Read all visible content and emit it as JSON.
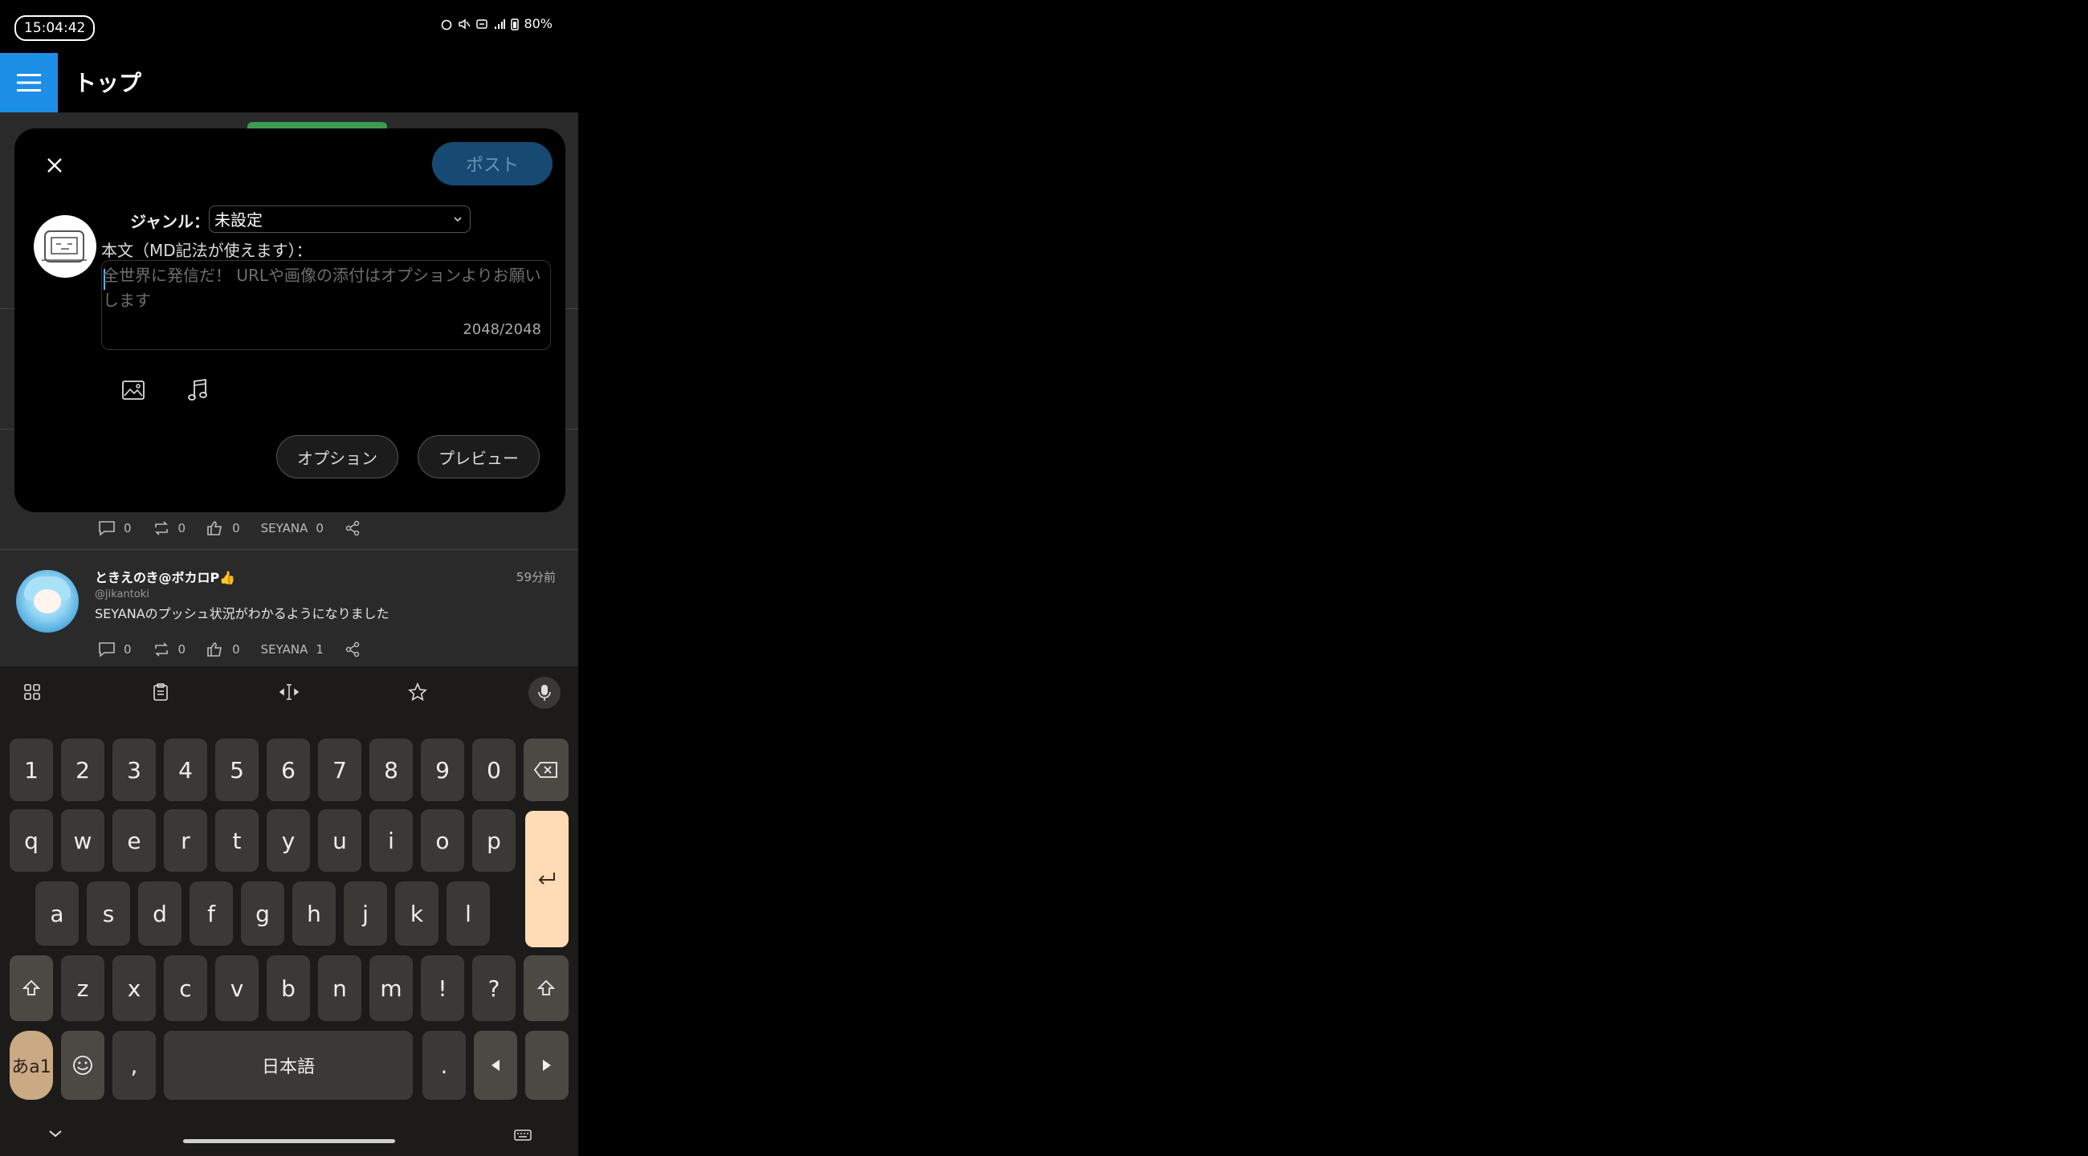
{
  "status_bar": {
    "time": "15:04:42",
    "battery": "80%"
  },
  "header": {
    "title": "トップ"
  },
  "modal": {
    "post_label": "ポスト",
    "genre_label": "ジャンル：",
    "genre_value": "未設定",
    "body_label": "本文（MD記法が使えます）：",
    "placeholder": "全世界に発信だ！ URLや画像の添付はオプションよりお願いします",
    "counter": "2048/2048",
    "option_label": "オプション",
    "preview_label": "プレビュー"
  },
  "feed": {
    "post1_actions": {
      "comments": "0",
      "reposts": "0",
      "likes": "0",
      "seyana_label": "SEYANA",
      "seyana": "0"
    },
    "post2": {
      "name": "ときえのき@ボカロP👍",
      "handle": "@jikantoki",
      "text": "SEYANAのプッシュ状況がわかるようになりました",
      "time": "59分前",
      "comments": "0",
      "reposts": "0",
      "likes": "0",
      "seyana_label": "SEYANA",
      "seyana": "1"
    }
  },
  "keyboard": {
    "number_row": [
      "1",
      "2",
      "3",
      "4",
      "5",
      "6",
      "7",
      "8",
      "9",
      "0"
    ],
    "row1": [
      "q",
      "w",
      "e",
      "r",
      "t",
      "y",
      "u",
      "i",
      "o",
      "p"
    ],
    "row2": [
      "a",
      "s",
      "d",
      "f",
      "g",
      "h",
      "j",
      "k",
      "l"
    ],
    "row3": [
      "z",
      "x",
      "c",
      "v",
      "b",
      "n",
      "m",
      "!",
      "?"
    ],
    "comma": ",",
    "period": ".",
    "space_label": "日本語",
    "lang_key": "あa1"
  },
  "colors": {
    "accent": "#1d8fe6",
    "post_button": "#164a73",
    "enter_key": "#ffdcb5"
  }
}
